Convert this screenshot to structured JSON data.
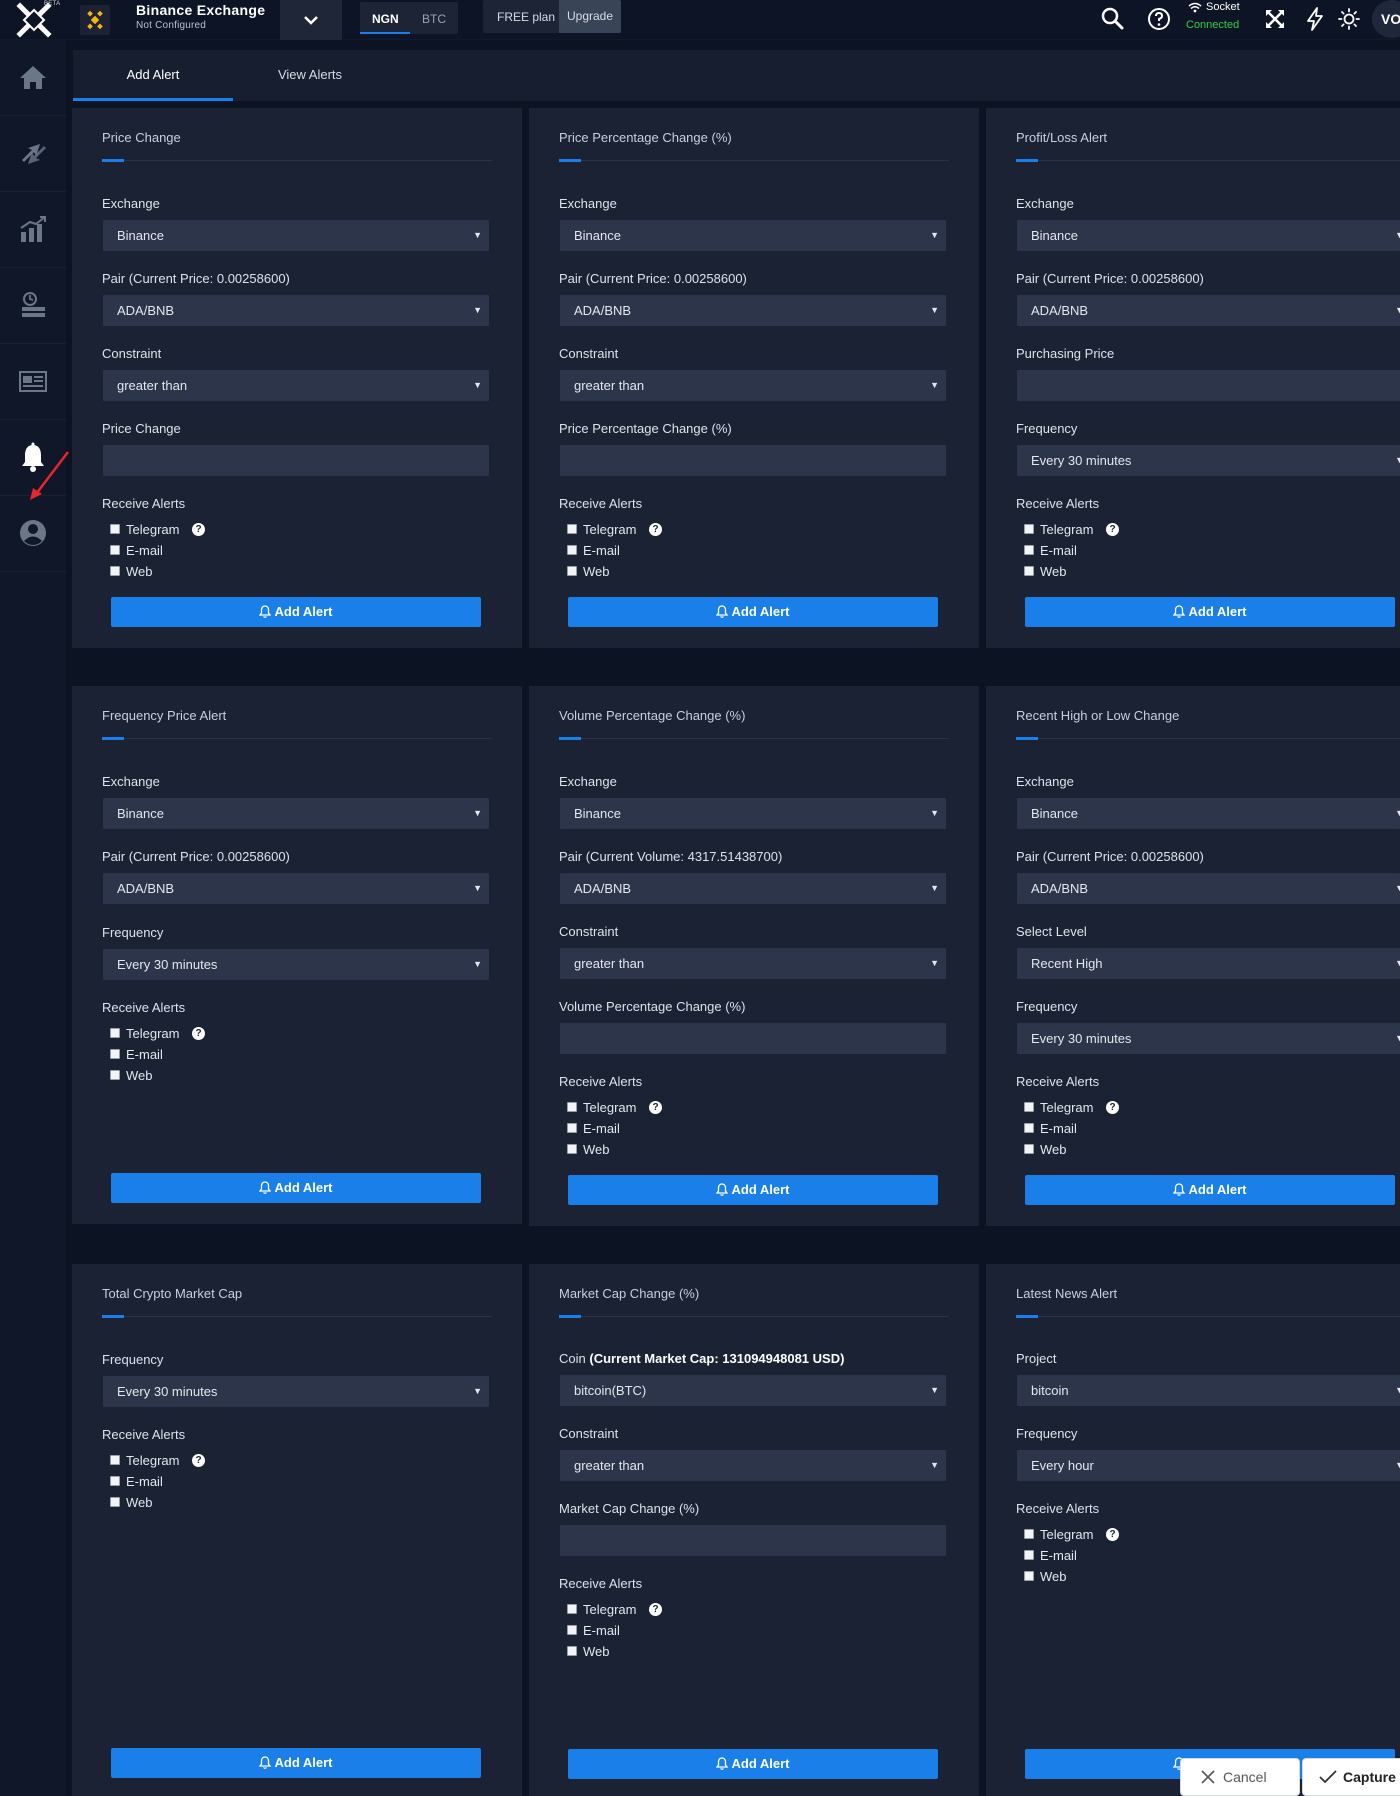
{
  "topbar": {
    "beta": "BETA",
    "exchange_name": "Binance Exchange",
    "exchange_status": "Not Configured",
    "currency_options": [
      "NGN",
      "BTC"
    ],
    "plan_label": "FREE plan",
    "upgrade_label": "Upgrade",
    "socket_label": "Socket",
    "socket_status": "Connected",
    "avatar_initials": "VO",
    "colors": {
      "accent": "#1a7fe8",
      "connected": "#2fce47",
      "binance": "#f0b90b"
    }
  },
  "sidebar": {
    "items": [
      "home-icon",
      "exchange-arrows-icon",
      "chart-icon",
      "portfolio-icon",
      "news-icon",
      "bell-icon",
      "user-icon"
    ],
    "active": "bell-icon"
  },
  "tabs": [
    "Add Alert",
    "View Alerts"
  ],
  "common": {
    "receive_alerts": "Receive Alerts",
    "telegram": "Telegram",
    "email": "E-mail",
    "web": "Web",
    "add_alert": "Add Alert",
    "help_glyph": "?",
    "caret": "▼"
  },
  "cards": {
    "price_change": {
      "title": "Price Change",
      "exchange_label": "Exchange",
      "exchange_value": "Binance",
      "pair_label": "Pair (Current Price: 0.00258600)",
      "pair_value": "ADA/BNB",
      "constraint_label": "Constraint",
      "constraint_value": "greater than",
      "input_label": "Price Change"
    },
    "price_pct_change": {
      "title": "Price Percentage Change (%)",
      "exchange_label": "Exchange",
      "exchange_value": "Binance",
      "pair_label": "Pair (Current Price: 0.00258600)",
      "pair_value": "ADA/BNB",
      "constraint_label": "Constraint",
      "constraint_value": "greater than",
      "input_label": "Price Percentage Change (%)"
    },
    "profit_loss": {
      "title": "Profit/Loss Alert",
      "exchange_label": "Exchange",
      "exchange_value": "Binance",
      "pair_label": "Pair (Current Price: 0.00258600)",
      "pair_value": "ADA/BNB",
      "purchase_label": "Purchasing Price",
      "frequency_label": "Frequency",
      "frequency_value": "Every 30 minutes"
    },
    "frequency_price": {
      "title": "Frequency Price Alert",
      "exchange_label": "Exchange",
      "exchange_value": "Binance",
      "pair_label": "Pair (Current Price: 0.00258600)",
      "pair_value": "ADA/BNB",
      "frequency_label": "Frequency",
      "frequency_value": "Every 30 minutes"
    },
    "volume_pct_change": {
      "title": "Volume Percentage Change (%)",
      "exchange_label": "Exchange",
      "exchange_value": "Binance",
      "pair_label": "Pair (Current Volume: 4317.51438700)",
      "pair_value": "ADA/BNB",
      "constraint_label": "Constraint",
      "constraint_value": "greater than",
      "input_label": "Volume Percentage Change (%)"
    },
    "recent_high_low": {
      "title": "Recent High or Low Change",
      "exchange_label": "Exchange",
      "exchange_value": "Binance",
      "pair_label": "Pair (Current Price: 0.00258600)",
      "pair_value": "ADA/BNB",
      "level_label": "Select Level",
      "level_value": "Recent High",
      "frequency_label": "Frequency",
      "frequency_value": "Every 30 minutes"
    },
    "total_market_cap": {
      "title": "Total Crypto Market Cap",
      "frequency_label": "Frequency",
      "frequency_value": "Every 30 minutes"
    },
    "market_cap_change": {
      "title": "Market Cap Change (%)",
      "coin_label": "Coin",
      "coin_detail": "(Current Market Cap: 131094948081 USD)",
      "coin_value": "bitcoin(BTC)",
      "constraint_label": "Constraint",
      "constraint_value": "greater than",
      "input_label": "Market Cap Change (%)"
    },
    "latest_news": {
      "title": "Latest News Alert",
      "project_label": "Project",
      "project_value": "bitcoin",
      "frequency_label": "Frequency",
      "frequency_value": "Every hour"
    }
  },
  "capture_overlay": {
    "cancel": "Cancel",
    "capture": "Capture"
  }
}
